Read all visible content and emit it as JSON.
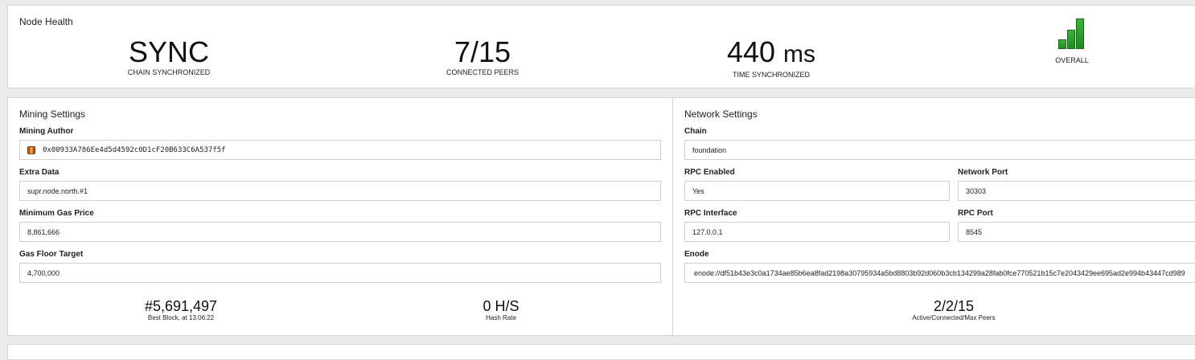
{
  "node_health": {
    "title": "Node Health",
    "stats": [
      {
        "value": "SYNC",
        "caption": "CHAIN SYNCHRONIZED"
      },
      {
        "value": "7/15",
        "caption": "CONNECTED PEERS"
      },
      {
        "value": "440",
        "unit": "ms",
        "caption": "TIME SYNCHRONIZED"
      }
    ],
    "overall": {
      "caption": "OVERALL",
      "icon": "signal-bars-icon",
      "level": 1.0,
      "color": "#2ea52e"
    }
  },
  "mining": {
    "title": "Mining Settings",
    "author_label": "Mining Author",
    "author_value": "0x00933A786Ee4d5d4592c0D1cF20B633C6A537f5f",
    "extra_label": "Extra Data",
    "extra_value": "supr.node.north.#1",
    "gas_price_label": "Minimum Gas Price",
    "gas_price_value": "8,861,666",
    "gas_floor_label": "Gas Floor Target",
    "gas_floor_value": "4,700,000",
    "best_block_value": "#5,691,497",
    "best_block_label": "Best Block, at 13:06:22",
    "hash_rate_value": "0 H/S",
    "hash_rate_label": "Hash Rate"
  },
  "network": {
    "title": "Network Settings",
    "chain_label": "Chain",
    "chain_value": "foundation",
    "rpc_enabled_label": "RPC Enabled",
    "rpc_enabled_value": "Yes",
    "port_label": "Network Port",
    "port_value": "30303",
    "rpc_interface_label": "RPC Interface",
    "rpc_interface_value": "127.0.0.1",
    "rpc_port_label": "RPC Port",
    "rpc_port_value": "8545",
    "enode_label": "Enode",
    "enode_value": "enode://df51b43e3c0a1734ae85b6ea8fad2198a30795934a5bd8803b92d060b3cb134299a28fab0fce770521b15c7e2043429ee695ad2e994b43447cd989",
    "peers_value": "2/2/15",
    "peers_label": "Active/Connected/Max Peers"
  }
}
